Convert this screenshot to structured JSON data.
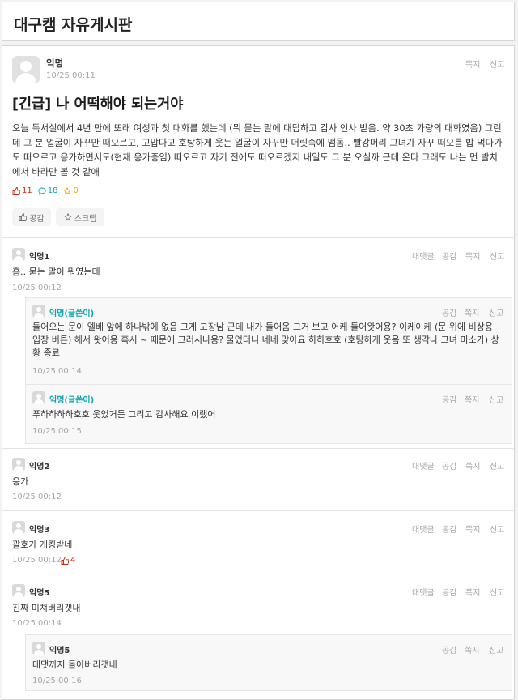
{
  "board": {
    "title": "대구캠 자유게시판"
  },
  "article": {
    "author": "익명",
    "time": "10/25 00:11",
    "actions": [
      "쪽지",
      "신고"
    ],
    "title": "[긴급] 나 어떡해야 되는거야",
    "body": "오늘 독서실에서 4년 만에 또래 여성과 첫 대화를 했는데 (뭐 묻는 말에 대답하고 감사 인사 받음. 약 30초 가량의 대화였음) 그런데 그 분 얼굴이 자꾸만 떠오르고, 고맙다고 호탕하게 웃는 얼굴이 자꾸만 머릿속에 맴돔.. 빨강머리 그녀가 자꾸 떠오름 밥 먹다가도 떠오르고 응가하면서도(현재 응가중임) 떠오르고 자기 전에도 떠오르겠지 내일도 그 분 오실까 근데 온다 그래도 나는 먼 발치에서 바라만 볼 것 같애",
    "vote_count": "11",
    "comment_count": "18",
    "scrap_count": "0",
    "vote_button": "공감",
    "scrap_button": "스크랩"
  },
  "comment_actions": [
    "대댓글",
    "공감",
    "쪽지",
    "신고"
  ],
  "child_actions": [
    "공감",
    "쪽지",
    "신고"
  ],
  "comments": [
    {
      "author": "익명1",
      "text": "흠.. 묻는 말이 뭐였는데",
      "time": "10/25 00:12",
      "children": [
        {
          "author": "익명(글쓴이)",
          "text": "들어오는 문이 엘베 앞에 하나밖에 없음 그게 고장남 근데 내가 들어옴 그거 보고 어케 들어왓어용? 이케이케 (문 위에 비상용 입장 버튼) 해서 왓어용 혹시 ~ 때문에 그러시나용? 물었더니 네네 맞아요 하하호호 (호탕하게 웃음 또 생각나 그녀 미소가) 상황 종료",
          "time": "10/25 00:14"
        },
        {
          "author": "익명(글쓴이)",
          "text": "푸하하하하호호 웃었거든 그리고 감사해요 이랬어",
          "time": "10/25 00:15"
        }
      ]
    },
    {
      "author": "익명2",
      "text": "응가",
      "time": "10/25 00:12"
    },
    {
      "author": "익명3",
      "text": "괄호가 개킹받네",
      "time": "10/25 00:12",
      "vote": "4"
    },
    {
      "author": "익명5",
      "text": "진짜 미쳐버리갯내",
      "time": "10/25 00:14",
      "children": [
        {
          "author": "익명5",
          "text": "대댓까지 돌아버리갯내",
          "time": "10/25 00:16"
        }
      ]
    }
  ]
}
